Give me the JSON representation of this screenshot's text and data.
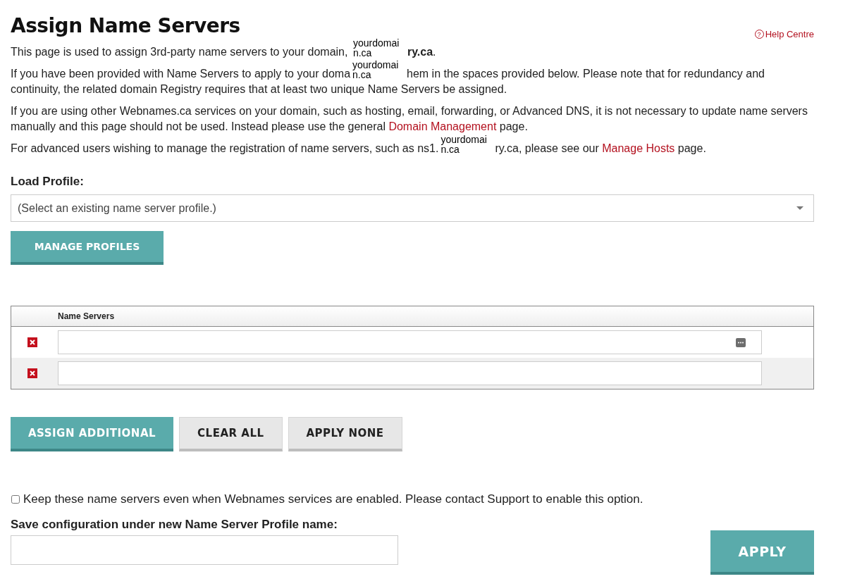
{
  "title": "Assign Name Servers",
  "help_link": {
    "icon": "?",
    "label": "Help Centre"
  },
  "paragraphs": [
    [
      {
        "kind": "text",
        "text": "This page is used to assign 3rd-party name servers to your domain, "
      },
      {
        "kind": "overlay",
        "lines": [
          "yourdomai",
          "n.ca"
        ]
      },
      {
        "kind": "bold",
        "text": "ry.ca"
      },
      {
        "kind": "text",
        "text": "."
      }
    ],
    [
      {
        "kind": "text",
        "text": "If you have been provided with Name Servers to apply to your doma"
      },
      {
        "kind": "overlay",
        "lines": [
          "yourdomai",
          "n.ca"
        ]
      },
      {
        "kind": "text",
        "text": "hem in the spaces provided below. Please note that for redundancy and continuity, the related domain Registry requires that at least two unique Name Servers be assigned."
      }
    ],
    [
      {
        "kind": "text",
        "text": "If you are using other Webnames.ca services on your domain, such as hosting, email, forwarding, or Advanced DNS, it is not necessary to update name servers manually and this page should not be used. Instead please use the general "
      },
      {
        "kind": "link",
        "text": "Domain Management"
      },
      {
        "kind": "text",
        "text": " page."
      }
    ],
    [
      {
        "kind": "text",
        "text": "For advanced users wishing to manage the registration of name servers, such as ns1."
      },
      {
        "kind": "overlay",
        "lines": [
          "yourdomai",
          "n.ca"
        ]
      },
      {
        "kind": "text",
        "text": "ry.ca, please see our "
      },
      {
        "kind": "link",
        "text": "Manage Hosts"
      },
      {
        "kind": "text",
        "text": " page."
      }
    ]
  ],
  "load_profile": {
    "label": "Load Profile:",
    "placeholder": "(Select an existing name server profile.)"
  },
  "manage_button": "MANAGE PROFILES",
  "table": {
    "columns": [
      "Name Servers"
    ],
    "rows": [
      {
        "menu_icon": true
      },
      {
        "menu_icon": false
      }
    ]
  },
  "buttons": [
    {
      "label": "ASSIGN ADDITIONAL",
      "kind": "primary"
    },
    {
      "label": "CLEAR ALL",
      "kind": "secondary"
    },
    {
      "label": "APPLY NONE",
      "kind": "secondary"
    }
  ],
  "keep_option": {
    "label": "Keep these name servers even when Webnames services are enabled. Please contact Support to enable this option.",
    "checked": false
  },
  "save": {
    "label": "Save configuration under new Name Server Profile name:"
  },
  "apply_button": "APPLY"
}
